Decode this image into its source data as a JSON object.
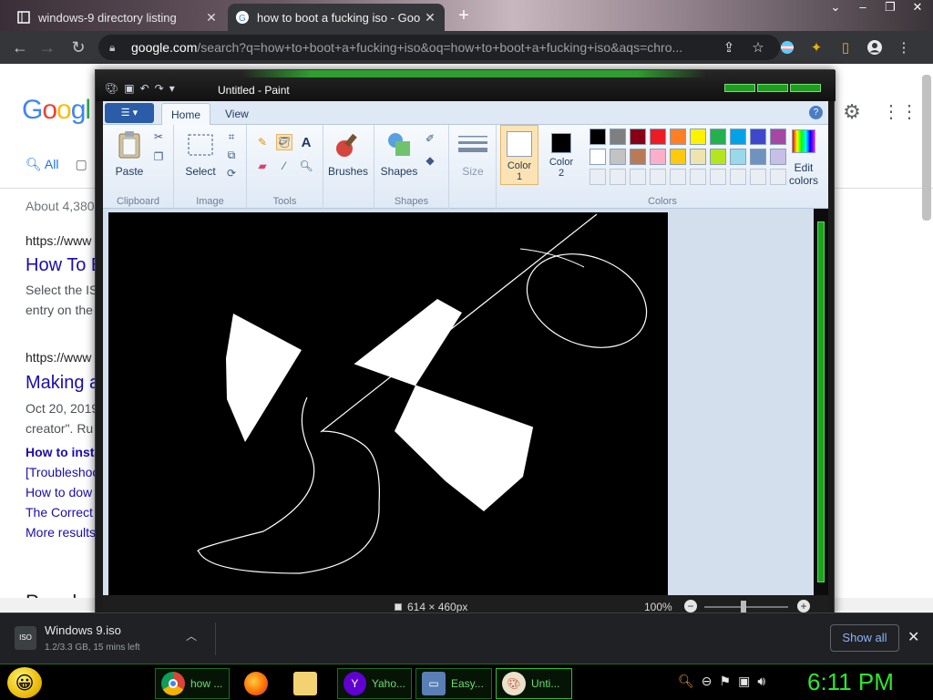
{
  "browser": {
    "tabs": [
      {
        "title": "windows-9 directory listing",
        "active": false
      },
      {
        "title": "how to boot a fucking iso - Goo",
        "active": true
      }
    ],
    "new_tab": "+",
    "url_host": "google.com",
    "url_path": "/search?q=how+to+boot+a+fucking+iso&oq=how+to+boot+a+fucking+iso&aqs=chro..."
  },
  "google": {
    "logo": "Googl",
    "tabs": [
      "All"
    ],
    "about": "About 4,380",
    "results": [
      {
        "url": "https://www",
        "title": "How To B",
        "snippet1": "Select the IS",
        "snippet2": "entry on the"
      },
      {
        "url": "https://www",
        "title": "Making a",
        "snippet1": "Oct 20, 2019",
        "snippet2": "creator\". Ru"
      }
    ],
    "sublinks": [
      "How to insta",
      "[Troubleshoo",
      "How to dow",
      "The Correct",
      "More results"
    ],
    "people": "People"
  },
  "paint": {
    "title": "Untitled - Paint",
    "tabs": [
      "Home",
      "View"
    ],
    "groups": {
      "clipboard": "Clipboard",
      "image": "Image",
      "tools": "Tools",
      "shapes": "Shapes",
      "colors": "Colors"
    },
    "buttons": {
      "paste": "Paste",
      "select": "Select",
      "brushes": "Brushes",
      "shapes": "Shapes",
      "size": "Size",
      "color1_a": "Color",
      "color1_b": "1",
      "color2_a": "Color",
      "color2_b": "2",
      "edit_a": "Edit",
      "edit_b": "colors"
    },
    "color1": "#ffffff",
    "color2": "#000000",
    "palette_row1": [
      "#000000",
      "#7f7f7f",
      "#880015",
      "#ed1c24",
      "#ff7f27",
      "#fff200",
      "#22b14c",
      "#00a2e8",
      "#3f48cc",
      "#a349a4"
    ],
    "palette_row2": [
      "#ffffff",
      "#c3c3c3",
      "#b97a57",
      "#ffaec9",
      "#ffc90e",
      "#efe4b0",
      "#b5e61d",
      "#99d9ea",
      "#7092be",
      "#c8bfe7"
    ],
    "status_dimensions": "614 × 460px",
    "zoom": "100%"
  },
  "download": {
    "icon_label": "ISO",
    "filename": "Windows 9.iso",
    "progress": "1.2/3.3 GB, 15 mins left",
    "show_all": "Show all"
  },
  "taskbar": {
    "items": [
      "how ...",
      "Yaho...",
      "Easy...",
      "Unti..."
    ],
    "clock": "6:11 PM"
  }
}
